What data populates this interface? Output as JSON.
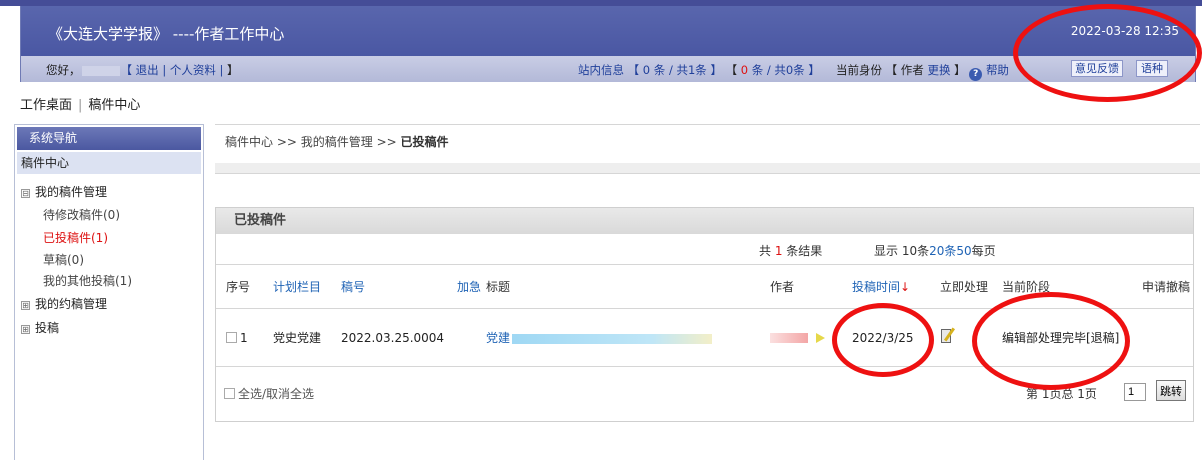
{
  "header": {
    "title": "《大连大学学报》 ----作者工作中心",
    "datetime": "2022-03-28 12:35",
    "greeting": "您好，",
    "logout": "【 退出",
    "profile": "| 个人资料 |",
    "bracket_close": "】",
    "messages_label": "站内信息 【 0 条 / 共1条 】",
    "messages_unread_prefix": "【 ",
    "messages_unread_count": "0",
    "messages_unread_suffix": " 条 / 共0条 】",
    "identity_label": "当前身份 【 作者",
    "switch_role": "更换",
    "identity_close": "】",
    "help_icon_glyph": "?",
    "help": "帮助",
    "feedback_button": "意见反馈",
    "language_button": "语种"
  },
  "top_nav": {
    "desktop": "工作桌面",
    "separator": "|",
    "manuscript_center": "稿件中心"
  },
  "sidebar": {
    "header": "系统导航",
    "section": "稿件中心",
    "groups": [
      {
        "label": "我的稿件管理",
        "expanded": true,
        "box": "⊟"
      },
      {
        "label": "我的约稿管理",
        "expanded": false,
        "box": "⊞"
      },
      {
        "label": "投稿",
        "expanded": false,
        "box": "⊞"
      }
    ],
    "items": [
      {
        "label": "待修改稿件(0)"
      },
      {
        "label": "已投稿件(1)",
        "active": true
      },
      {
        "label": "草稿(0)"
      },
      {
        "label": "我的其他投稿(1)"
      }
    ]
  },
  "breadcrumb": {
    "p1": "稿件中心",
    "sep1": " >> ",
    "p2": "我的稿件管理",
    "sep2": " >> ",
    "current": "已投稿件"
  },
  "panel": {
    "title": "已投稿件",
    "summary_prefix": "共 ",
    "summary_count": "1",
    "summary_suffix": " 条结果",
    "page_size_prefix": "显示 10条",
    "page_size_20": "20条",
    "page_size_50": "50",
    "page_size_suffix": "每页"
  },
  "table": {
    "headers": {
      "no": "序号",
      "column": "计划栏目",
      "manuscript_no": "稿号",
      "urgent": "加急",
      "title": "标题",
      "author": "作者",
      "submit_time": "投稿时间",
      "sort_arrow": "↓",
      "process": "立即处理",
      "stage": "当前阶段",
      "withdraw": "申请撤稿"
    },
    "rows": [
      {
        "no": "1",
        "column": "党史党建",
        "manuscript_no": "2022.03.25.0004",
        "urgent": "",
        "title_visible": "党建",
        "submit_time": "2022/3/25",
        "stage": "编辑部处理完毕[退稿]",
        "withdraw": ""
      }
    ]
  },
  "footer": {
    "select_all": "全选/取消全选",
    "page_info": "第 1页总 1页",
    "page_input": "1",
    "jump_button": "跳转"
  },
  "colors": {
    "header_blue": "#4a57a3",
    "link_blue": "#1f63b5",
    "active_red": "#dd1111",
    "annotation_red": "#ee1111"
  }
}
